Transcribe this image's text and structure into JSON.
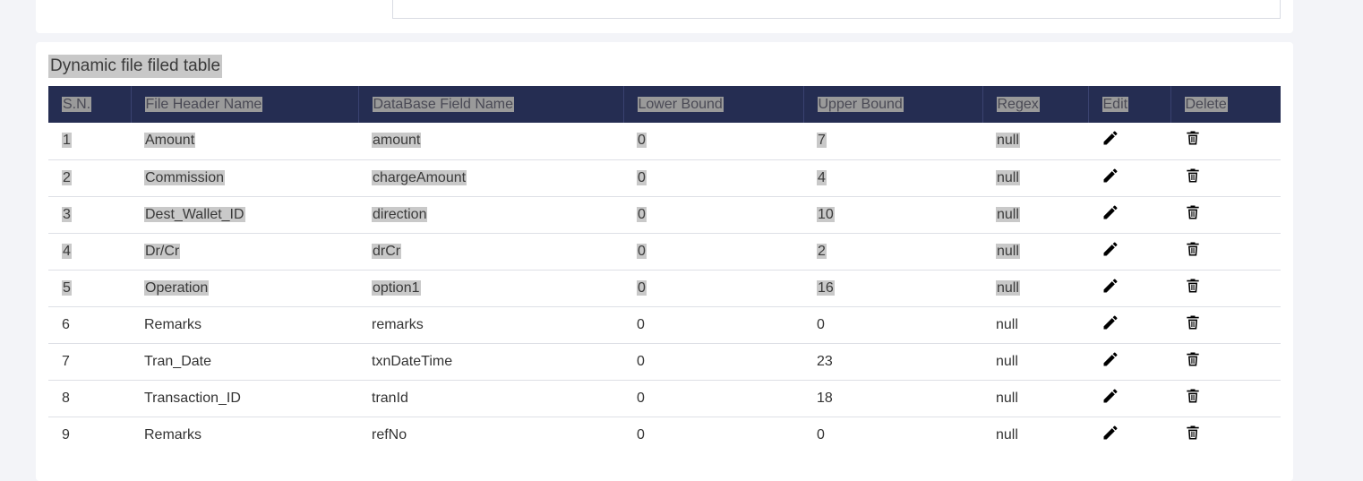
{
  "table": {
    "title": "Dynamic file filed table",
    "columns": [
      "S.N.",
      "File Header Name",
      "DataBase Field Name",
      "Lower Bound",
      "Upper Bound",
      "Regex",
      "Edit",
      "Delete"
    ],
    "rows": [
      {
        "sn": "1",
        "file_header": "Amount",
        "db_field": "amount",
        "lower": "0",
        "upper": "7",
        "regex": "null",
        "selected": true
      },
      {
        "sn": "2",
        "file_header": "Commission",
        "db_field": "chargeAmount",
        "lower": "0",
        "upper": "4",
        "regex": "null",
        "selected": true
      },
      {
        "sn": "3",
        "file_header": "Dest_Wallet_ID",
        "db_field": "direction",
        "lower": "0",
        "upper": "10",
        "regex": "null",
        "selected": true
      },
      {
        "sn": "4",
        "file_header": "Dr/Cr",
        "db_field": "drCr",
        "lower": "0",
        "upper": "2",
        "regex": "null",
        "selected": true
      },
      {
        "sn": "5",
        "file_header": "Operation",
        "db_field": "option1",
        "lower": "0",
        "upper": "16",
        "regex": "null",
        "selected": true
      },
      {
        "sn": "6",
        "file_header": "Remarks",
        "db_field": "remarks",
        "lower": "0",
        "upper": "0",
        "regex": "null",
        "selected": false
      },
      {
        "sn": "7",
        "file_header": "Tran_Date",
        "db_field": "txnDateTime",
        "lower": "0",
        "upper": "23",
        "regex": "null",
        "selected": false
      },
      {
        "sn": "8",
        "file_header": "Transaction_ID",
        "db_field": "tranId",
        "lower": "0",
        "upper": "18",
        "regex": "null",
        "selected": false
      },
      {
        "sn": "9",
        "file_header": "Remarks",
        "db_field": "refNo",
        "lower": "0",
        "upper": "0",
        "regex": "null",
        "selected": false
      }
    ],
    "icons": {
      "edit": "pencil-icon",
      "delete": "trash-icon"
    }
  },
  "colors": {
    "header_bg": "#252d52",
    "page_bg": "#f3f4f8",
    "card_bg": "#ffffff",
    "selection": "#c9c9c9"
  }
}
